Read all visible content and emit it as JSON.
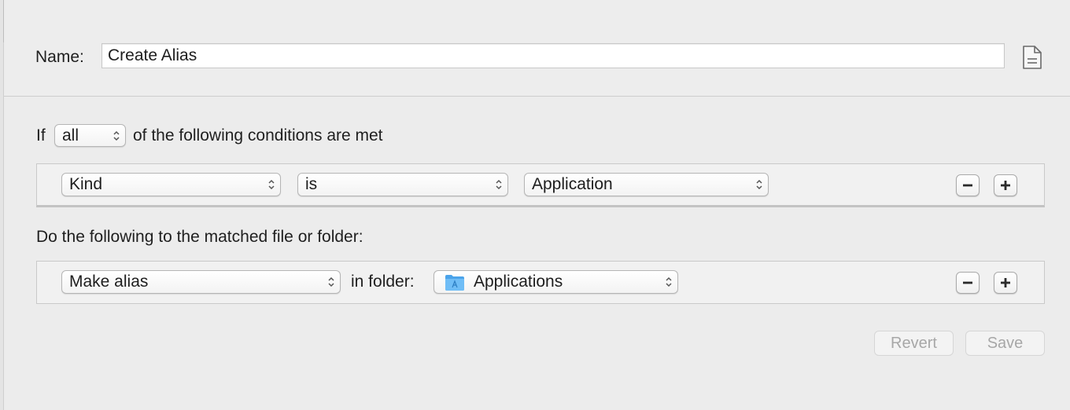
{
  "name_row": {
    "label": "Name:",
    "value": "Create Alias"
  },
  "conditions": {
    "prefix": "If",
    "match_selector": "all",
    "suffix": "of the following conditions are met",
    "rule": {
      "attribute": "Kind",
      "operator": "is",
      "value": "Application"
    }
  },
  "actions": {
    "heading": "Do the following to the matched file or folder:",
    "rule": {
      "action": "Make alias",
      "connector": "in folder:",
      "folder": "Applications"
    }
  },
  "buttons": {
    "revert": "Revert",
    "save": "Save"
  },
  "icons": {
    "document": "document-icon",
    "folder": "applications-folder-icon",
    "remove": "minus-icon",
    "add": "plus-icon",
    "popup_arrows": "up-down-chevron-icon"
  },
  "colors": {
    "background": "#ececec",
    "folder_blue": "#5fb4f3",
    "disabled_text": "#a7a7a7"
  }
}
